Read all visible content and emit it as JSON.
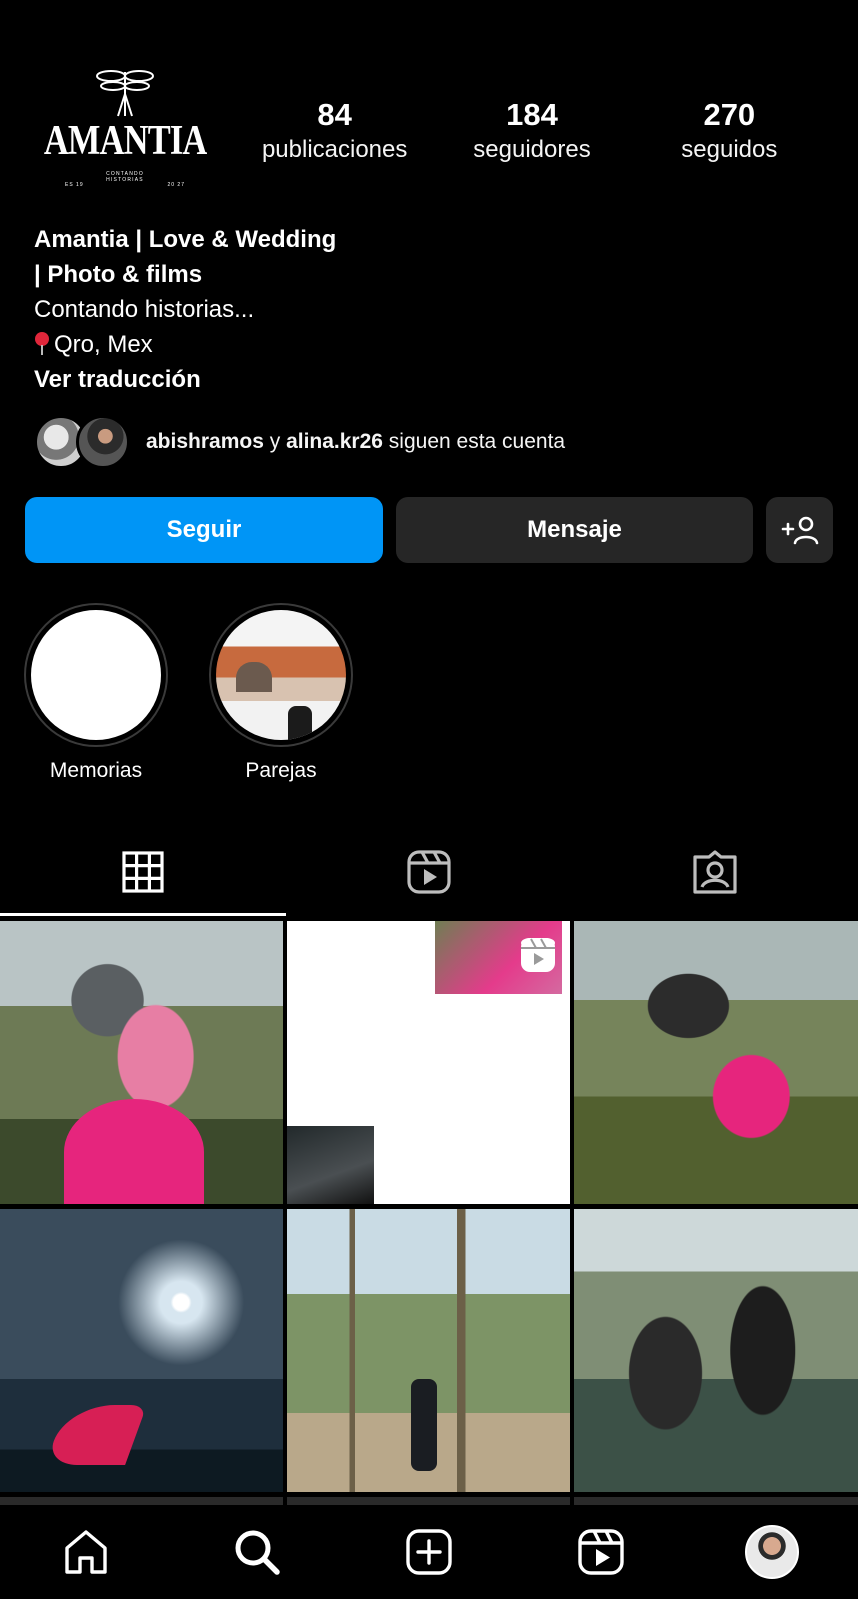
{
  "profile": {
    "logo": {
      "brand": "AMANTIA",
      "tagline": "CONTANDO HISTORIAS",
      "corner_left": "ES 19",
      "corner_right": "20 27"
    },
    "stats": [
      {
        "value": "84",
        "label": "publicaciones"
      },
      {
        "value": "184",
        "label": "seguidores"
      },
      {
        "value": "270",
        "label": "seguidos"
      }
    ],
    "bio": {
      "name_line1": "Amantia | Love & Wedding",
      "name_line2": "| Photo & films",
      "line3": "Contando historias...",
      "location": "Qro, Mex",
      "translate": "Ver traducción"
    },
    "followed_by": {
      "user1": "abishramos",
      "connector": " y ",
      "user2": "alina.kr26",
      "suffix": " siguen esta cuenta"
    }
  },
  "actions": {
    "follow": "Seguir",
    "message": "Mensaje"
  },
  "highlights": [
    {
      "label": "Memorias"
    },
    {
      "label": "Parejas"
    }
  ],
  "tabs": [
    {
      "icon": "grid-icon",
      "active": true
    },
    {
      "icon": "reels-icon",
      "active": false
    },
    {
      "icon": "tagged-icon",
      "active": false
    }
  ],
  "bottom_nav": [
    "home-icon",
    "search-icon",
    "create-icon",
    "reels-icon",
    "profile-avatar"
  ],
  "colors": {
    "background": "#000000",
    "primary_button": "#0095f6",
    "secondary_button": "#262626",
    "text": "#ffffff"
  }
}
